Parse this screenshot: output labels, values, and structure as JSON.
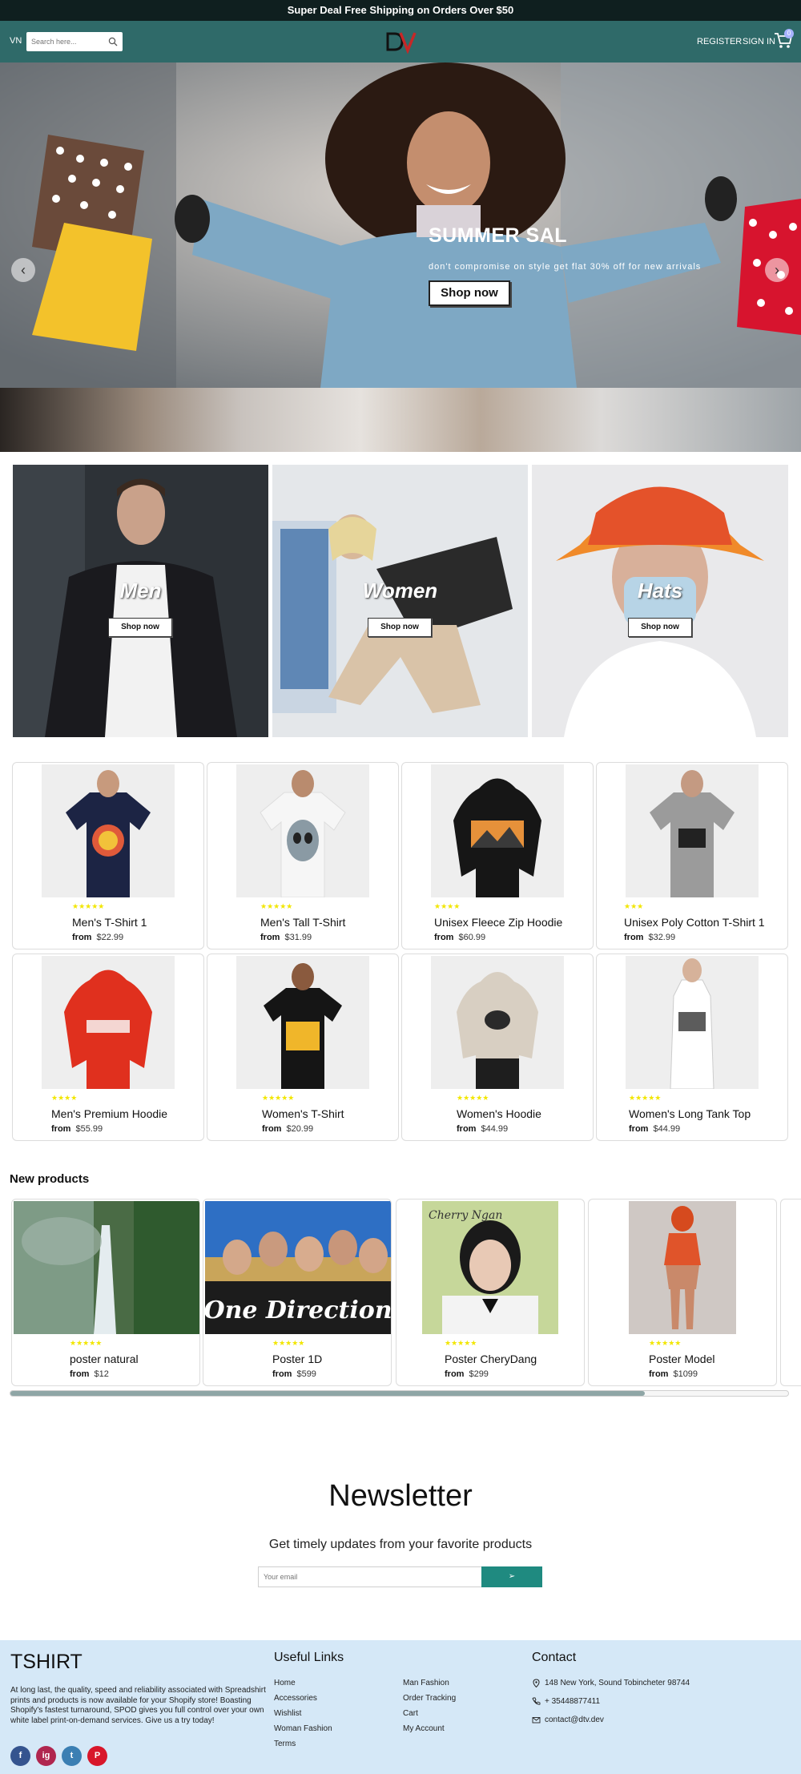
{
  "announcement": "Super Deal Free Shipping on Orders Over $50",
  "header": {
    "lang": "VN",
    "search_placeholder": "Search here...",
    "register": "REGISTER",
    "sign_in": "SIGN IN",
    "cart_count": "0",
    "accent": "#2f6a69"
  },
  "hero": {
    "title": "SUMMER SAL",
    "subtitle": "don't compromise on style get flat 30% off for new arrivals",
    "button": "Shop now",
    "prev": "‹",
    "next": "›"
  },
  "categories": [
    {
      "label": "Men",
      "button": "Shop now"
    },
    {
      "label": "Women",
      "button": "Shop now"
    },
    {
      "label": "Hats",
      "button": "Shop now"
    }
  ],
  "products": [
    {
      "name": "Men's T-Shirt 1",
      "from": "from",
      "price": "$22.99",
      "stars": "★★★★★"
    },
    {
      "name": "Men's Tall T-Shirt",
      "from": "from",
      "price": "$31.99",
      "stars": "★★★★★"
    },
    {
      "name": "Unisex Fleece Zip Hoodie",
      "from": "from",
      "price": "$60.99",
      "stars": "★★★★"
    },
    {
      "name": "Unisex Poly Cotton T-Shirt 1",
      "from": "from",
      "price": "$32.99",
      "stars": "★★★"
    },
    {
      "name": "Men's Premium Hoodie",
      "from": "from",
      "price": "$55.99",
      "stars": "★★★★"
    },
    {
      "name": "Women's T-Shirt",
      "from": "from",
      "price": "$20.99",
      "stars": "★★★★★"
    },
    {
      "name": "Women's Hoodie",
      "from": "from",
      "price": "$44.99",
      "stars": "★★★★★"
    },
    {
      "name": "Women's Long Tank Top",
      "from": "from",
      "price": "$44.99",
      "stars": "★★★★★"
    }
  ],
  "new_products": {
    "title": "New products",
    "items": [
      {
        "name": "poster natural",
        "from": "from",
        "price": "$12",
        "stars": "★★★★★"
      },
      {
        "name": "Poster 1D",
        "from": "from",
        "price": "$599",
        "stars": "★★★★★",
        "overlay": "One Direction"
      },
      {
        "name": "Poster CheryDang",
        "from": "from",
        "price": "$299",
        "stars": "★★★★★",
        "overlay": "Cherry Ngan"
      },
      {
        "name": "Poster Model",
        "from": "from",
        "price": "$1099",
        "stars": "★★★★★"
      }
    ]
  },
  "newsletter": {
    "title": "Newsletter",
    "subtitle": "Get timely updates from your favorite products",
    "placeholder": "Your email",
    "button": "➢"
  },
  "footer": {
    "brand": "TSHIRT",
    "description": "At long last, the quality, speed and reliability associated with Spreadshirt prints and products is now available for your Shopify store! Boasting Shopify's fastest turnaround, SPOD gives you full control over your own white label print-on-demand services. Give us a try today!",
    "useful_links_title": "Useful Links",
    "links_col1": [
      "Home",
      "Accessories",
      "Wishlist",
      "Woman Fashion",
      "Terms"
    ],
    "links_col2": [
      "Man Fashion",
      "Order Tracking",
      "Cart",
      "My Account"
    ],
    "contact_title": "Contact",
    "address": "148 New York, Sound Tobincheter 98744",
    "phone": "+ 35448877411",
    "email": "contact@dtv.dev",
    "social": [
      "f",
      "ig",
      "t",
      "P"
    ]
  }
}
